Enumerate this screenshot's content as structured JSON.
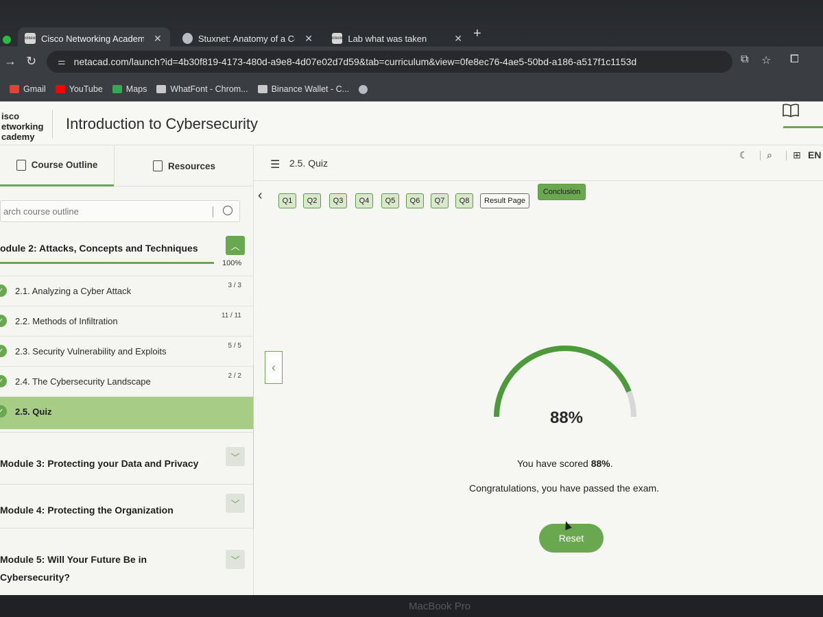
{
  "browser": {
    "tabs": [
      {
        "title": "Cisco Networking Academy: I",
        "active": true
      },
      {
        "title": "Stuxnet: Anatomy of a Compu",
        "active": false
      },
      {
        "title": "Lab what was taken",
        "active": false
      }
    ],
    "url": "netacad.com/launch?id=4b30f819-4173-480d-a9e8-4d07e02d7d59&tab=curriculum&view=0fe8ec76-4ae5-50bd-a186-a517f1c1153d",
    "bookmarks": [
      "Gmail",
      "YouTube",
      "Maps",
      "WhatFont - Chrom...",
      "Binance Wallet - C..."
    ]
  },
  "site": {
    "logo_lines": [
      "isco",
      "etworking",
      "cademy"
    ],
    "course_title": "Introduction to Cybersecurity"
  },
  "sidebar": {
    "tabs": [
      "Course Outline",
      "Resources"
    ],
    "search_placeholder": "arch course outline",
    "module2": {
      "title": "odule 2: Attacks, Concepts and Techniques",
      "progress_pct": "100%",
      "progress_value": 1.0,
      "lessons": [
        {
          "label": "2.1. Analyzing a Cyber Attack",
          "count": "3 / 3"
        },
        {
          "label": "2.2. Methods of Infiltration",
          "count": "11 / 11"
        },
        {
          "label": "2.3. Security Vulnerability and Exploits",
          "count": "5 / 5"
        },
        {
          "label": "2.4. The Cybersecurity Landscape",
          "count": "2 / 2"
        },
        {
          "label": "2.5. Quiz",
          "count": ""
        }
      ]
    },
    "module3": {
      "title": "Module 3: Protecting your Data and Privacy"
    },
    "module4": {
      "title": "Module 4: Protecting the Organization"
    },
    "module5": {
      "title_line1": "Module 5: Will Your Future Be in",
      "title_line2": "Cybersecurity?"
    }
  },
  "main": {
    "section_title": "2.5. Quiz",
    "language": "EN",
    "quiz_nav": [
      "Q1",
      "Q2",
      "Q3",
      "Q4",
      "Q5",
      "Q6",
      "Q7",
      "Q8"
    ],
    "result_page": "Result Page",
    "conclusion": "Conclusion",
    "score": {
      "value": 88,
      "display": "88%",
      "scored_prefix": "You have scored ",
      "scored_value": "88%",
      "scored_suffix": ".",
      "message": "Congratulations, you have passed the exam."
    },
    "reset_label": "Reset"
  },
  "device_label": "MacBook Pro",
  "colors": {
    "accent": "#6aa84f",
    "current_lesson": "#a7cc86",
    "gauge_track": "#d8d8d8"
  }
}
